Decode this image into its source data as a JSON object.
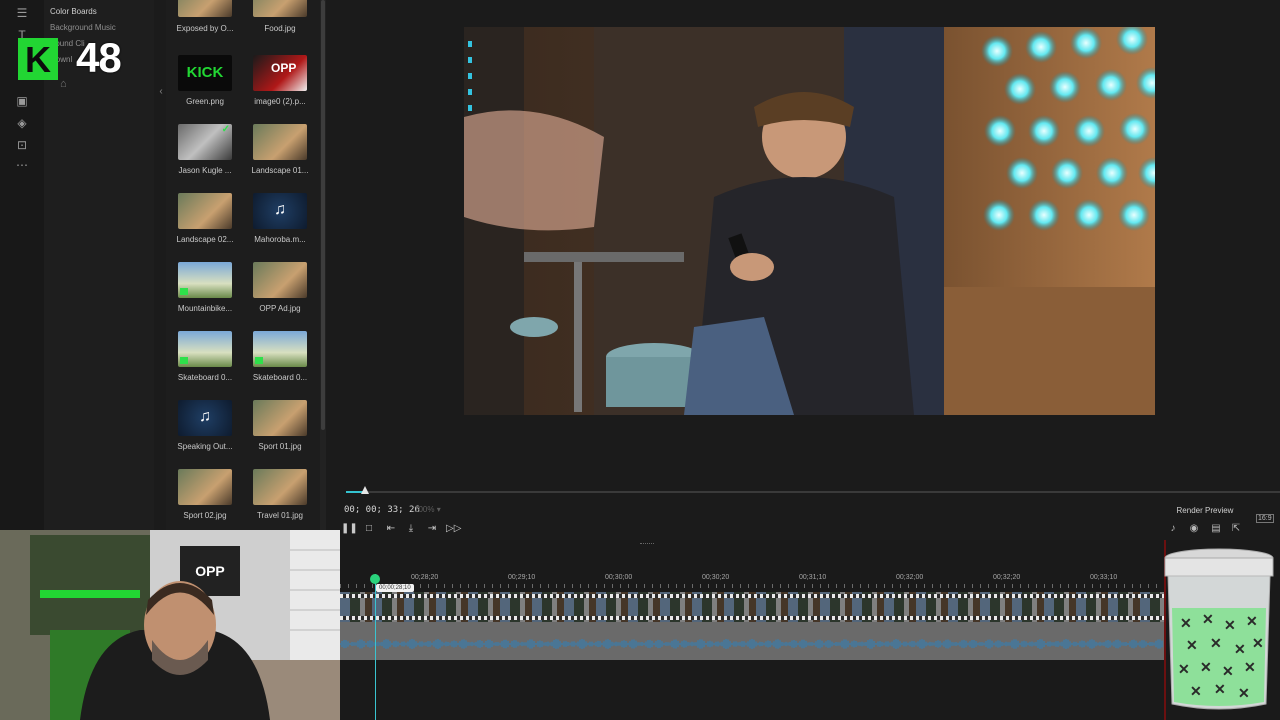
{
  "sidebar": {
    "categories": [
      {
        "label": "Color Boards"
      },
      {
        "label": "Background Music"
      },
      {
        "label": "Sound Cli"
      },
      {
        "label": "Downl"
      }
    ]
  },
  "media": {
    "items": [
      {
        "label": "Exposed by O...",
        "kind": "photo"
      },
      {
        "label": "Food.jpg",
        "kind": "photo"
      },
      {
        "label": "Green.png",
        "kind": "kick"
      },
      {
        "label": "image0 (2).p...",
        "kind": "opp"
      },
      {
        "label": "Jason Kugle ...",
        "kind": "photo-checked"
      },
      {
        "label": "Landscape 01...",
        "kind": "photo"
      },
      {
        "label": "Landscape 02...",
        "kind": "photo"
      },
      {
        "label": "Mahoroba.m...",
        "kind": "audio"
      },
      {
        "label": "Mountainbike...",
        "kind": "video"
      },
      {
        "label": "OPP Ad.jpg",
        "kind": "photo"
      },
      {
        "label": "Skateboard 0...",
        "kind": "video"
      },
      {
        "label": "Skateboard 0...",
        "kind": "video"
      },
      {
        "label": "Speaking Out...",
        "kind": "audio"
      },
      {
        "label": "Sport 01.jpg",
        "kind": "photo"
      },
      {
        "label": "Sport 02.jpg",
        "kind": "photo"
      },
      {
        "label": "Travel 01.jpg",
        "kind": "photo"
      }
    ],
    "kick_text": "KICK",
    "opp_text": "OPP"
  },
  "transport": {
    "timecode": "00; 00; 33; 26",
    "zoom": "100%",
    "render_label": "Render Preview",
    "aspect": "16:9"
  },
  "timeline": {
    "ruler_labels": [
      "00;28;20",
      "00;29;10",
      "00;30;00",
      "00;30;20",
      "00;31;10",
      "00;32;00",
      "00;32;20",
      "00;33;10"
    ],
    "playhead_tooltip": "00;00;28;10"
  },
  "overlay": {
    "logo_number": "48",
    "logo_letter": "K"
  },
  "colors": {
    "accent": "#34c3d0",
    "kick_green": "#22d633"
  }
}
